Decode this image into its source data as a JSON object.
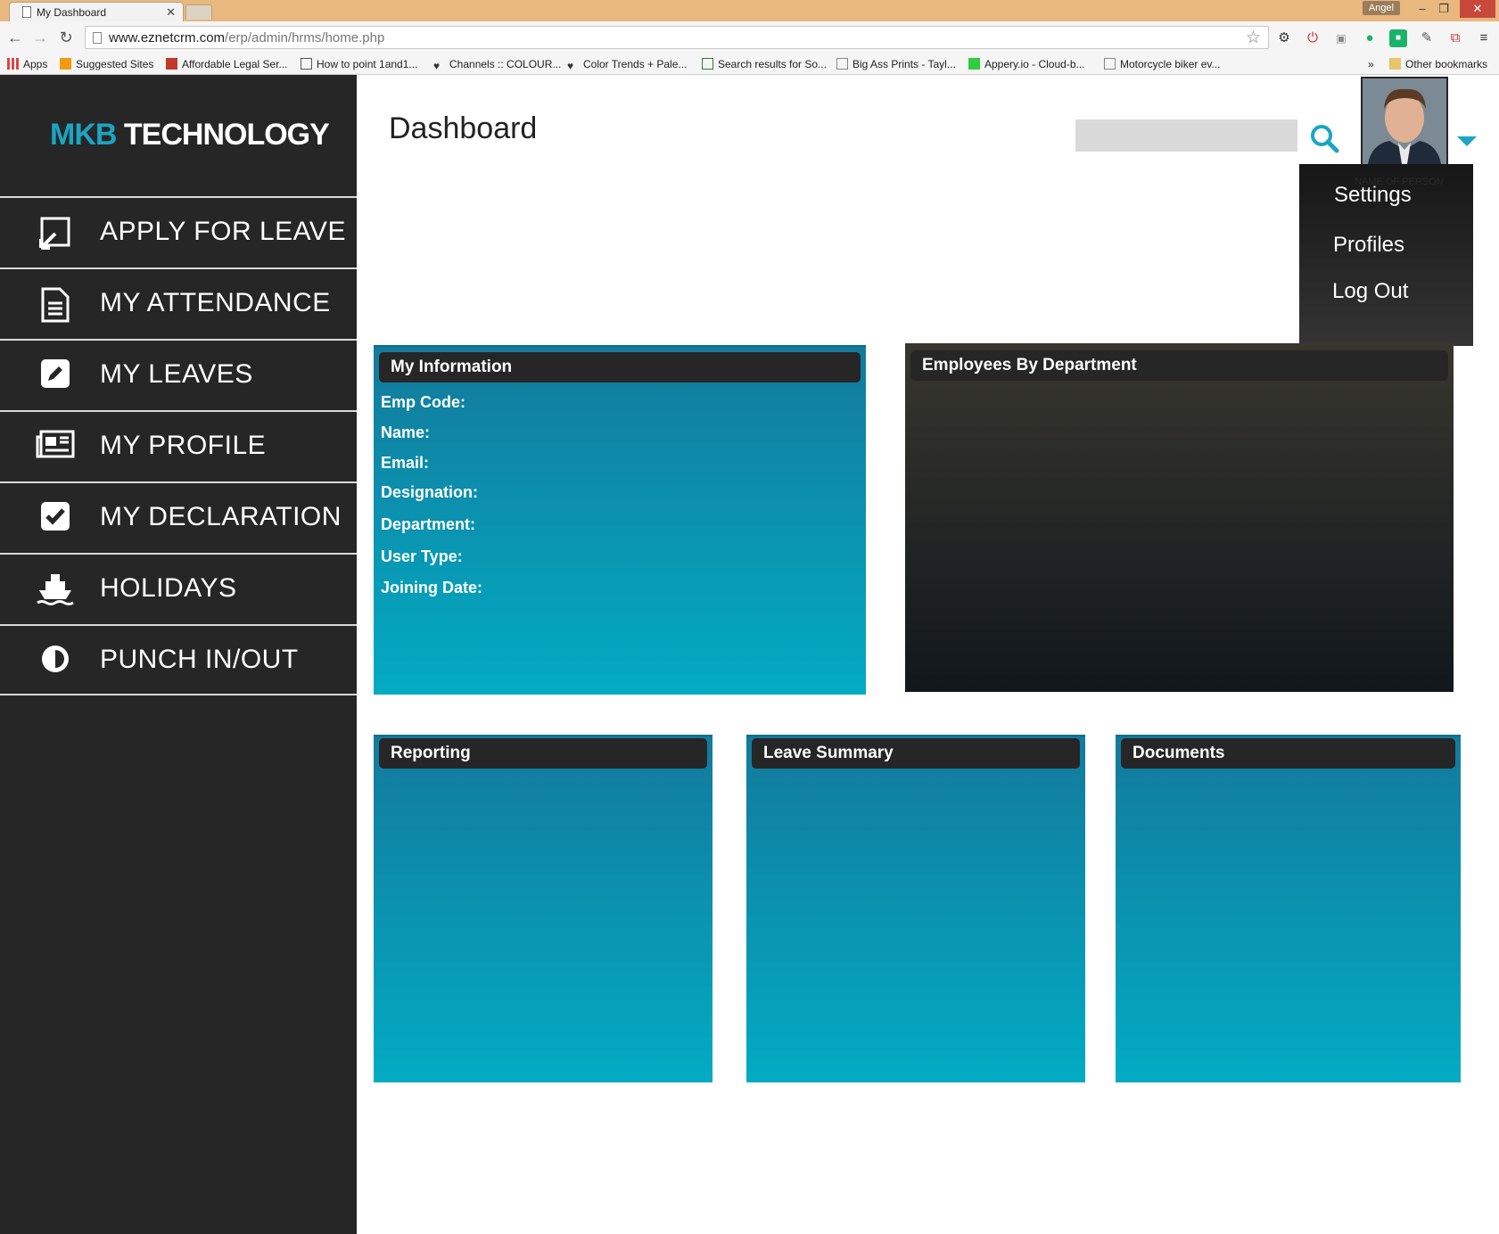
{
  "browser": {
    "tab_title": "My Dashboard",
    "profile_name": "Angel",
    "url_host": "www.eznetcrm.com",
    "url_path": "/erp/admin/hrms/home.php",
    "bookmarks": [
      "Apps",
      "Suggested Sites",
      "Affordable Legal Ser...",
      "How to point 1and1...",
      "Channels :: COLOUR...",
      "Color Trends + Pale...",
      "Search results for So...",
      "Big Ass Prints - Tayl...",
      "Appery.io - Cloud-b...",
      "Motorcycle biker ev..."
    ],
    "bookmarks_overflow": "»",
    "other_bookmarks": "Other bookmarks"
  },
  "app": {
    "logo_mkb": "MKB",
    "logo_rest": "TECHNOLOGY",
    "nav": [
      {
        "label": "APPLY FOR LEAVE",
        "icon": "edit-box-icon"
      },
      {
        "label": "MY ATTENDANCE",
        "icon": "document-icon"
      },
      {
        "label": "MY LEAVES",
        "icon": "pencil-square-icon"
      },
      {
        "label": "MY PROFILE",
        "icon": "newspaper-icon"
      },
      {
        "label": "MY DECLARATION",
        "icon": "checkbox-icon"
      },
      {
        "label": "HOLIDAYS",
        "icon": "ship-icon"
      },
      {
        "label": "PUNCH IN/OUT",
        "icon": "half-circle-icon"
      }
    ],
    "page_title": "Dashboard",
    "search_placeholder": "",
    "person_name": "NAME OF PERSON",
    "menu": [
      "Settings",
      "Profiles",
      "Log Out"
    ]
  },
  "cards": {
    "my_information": {
      "title": "My Information",
      "fields": [
        "Emp Code:",
        "Name:",
        "Email:",
        "Designation:",
        "Department:",
        "User Type:",
        "Joining Date:"
      ]
    },
    "employees_by_department": {
      "title": "Employees By Department"
    },
    "reporting": {
      "title": "Reporting"
    },
    "leave_summary": {
      "title": "Leave Summary"
    },
    "documents": {
      "title": "Documents"
    }
  },
  "colors": {
    "accent": "#1aa5c4",
    "sidebar": "#262626",
    "card_top": "#137a9c",
    "card_bottom": "#02abc3"
  }
}
